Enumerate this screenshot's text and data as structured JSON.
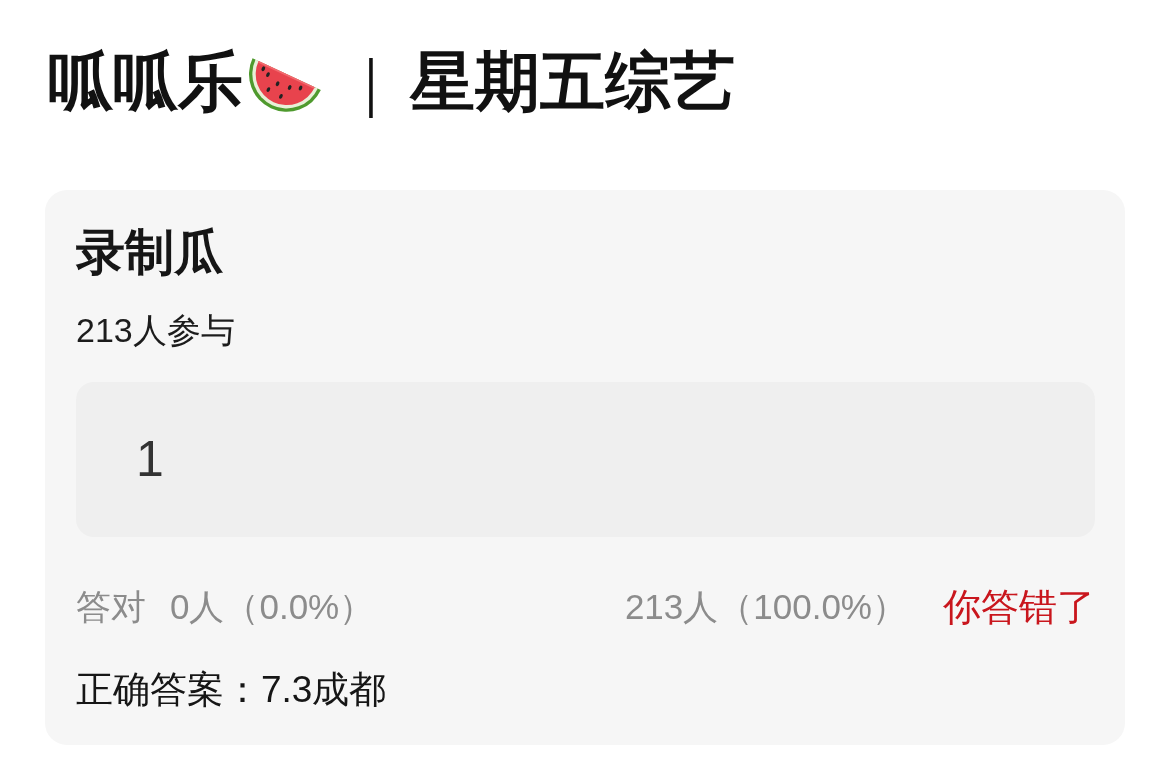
{
  "header": {
    "title": "呱呱乐",
    "separator": "｜",
    "subtitle": "星期五综艺"
  },
  "quiz": {
    "title": "录制瓜",
    "participants": "213人参与",
    "answer": {
      "value": "1"
    },
    "stats": {
      "correct_label": "答对",
      "correct_count": "0人（0.0%）",
      "wrong_count": "213人（100.0%）"
    },
    "result": {
      "correct": false,
      "label": "你答错了"
    },
    "correct_answer": "正确答案：7.3成都"
  }
}
